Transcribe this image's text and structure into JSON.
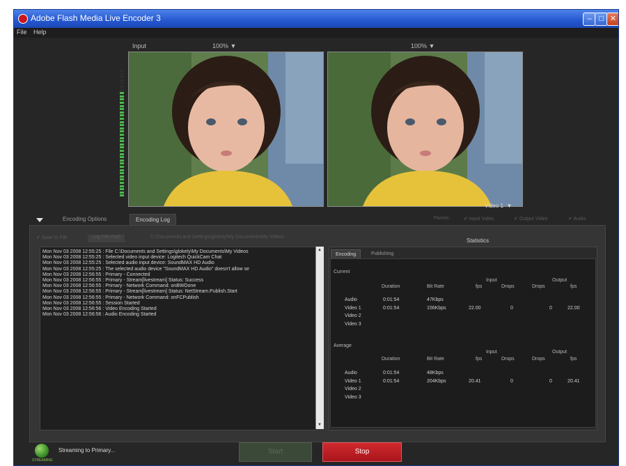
{
  "window": {
    "title": "Adobe Flash Media Live Encoder 3",
    "menu": [
      "File",
      "Help"
    ]
  },
  "preview": {
    "input_label": "Input",
    "input_zoom": "100%",
    "output_zoom": "100%",
    "video_select": "Video 1",
    "vu_level": 0.82
  },
  "tabs": {
    "encoding_options": "Encoding Options",
    "encoding_log": "Encoding Log"
  },
  "panel_toggles": {
    "label": "Panels:",
    "items": [
      "Input Video",
      "Output Video",
      "Audio"
    ]
  },
  "log_toolbar": {
    "save_to_file": "Save to File",
    "log_file_path": "C:\\Documents and Settings\\glokely\\My Documents\\My Videos"
  },
  "log": {
    "lines": [
      "Mon Nov 03 2008 12:55:25 : File C:\\Documents and Settings\\glokely\\My Documents\\My Videos",
      "Mon Nov 03 2008 12:55:25 : Selected video input device: Logitech QuickCam Chat",
      "Mon Nov 03 2008 12:55:25 : Selected audio input device: SoundMAX HD Audio",
      "Mon Nov 03 2008 12:55:25 : The selected audio device \"SoundMAX HD Audio\" doesn't allow se",
      "Mon Nov 03 2008 12:56:55 : Primary - Connected",
      "Mon Nov 03 2008 12:56:55 : Primary - Stream[livestream] Status: Success",
      "Mon Nov 03 2008 12:56:55 : Primary - Network Command: onBWDone",
      "Mon Nov 03 2008 12:56:55 : Primary - Stream[livestream] Status: NetStream.Publish.Start",
      "Mon Nov 03 2008 12:56:55 : Primary - Network Command: onFCPublish",
      "Mon Nov 03 2008 12:56:55 : Session Started",
      "Mon Nov 03 2008 12:56:56 : Video Encoding Started",
      "Mon Nov 03 2008 12:56:56 : Audio Encoding Started"
    ]
  },
  "stats": {
    "title": "Statistics",
    "tabs": [
      "Encoding",
      "Publishing"
    ],
    "current_label": "Current",
    "average_label": "Average",
    "col_headers": {
      "duration": "Duration",
      "bitrate": "Bit Rate",
      "input": "Input",
      "output": "Output",
      "fps": "fps",
      "drops": "Drops"
    },
    "current": [
      {
        "name": "Audio",
        "duration": "0:01:54",
        "bitrate": "47Kbps",
        "in_fps": "",
        "in_drops": "",
        "out_drops": "",
        "out_fps": ""
      },
      {
        "name": "Video 1",
        "duration": "0:01:54",
        "bitrate": "156Kbps",
        "in_fps": "22.00",
        "in_drops": "0",
        "out_drops": "0",
        "out_fps": "22.00"
      },
      {
        "name": "Video 2",
        "duration": "",
        "bitrate": "",
        "in_fps": "",
        "in_drops": "",
        "out_drops": "",
        "out_fps": ""
      },
      {
        "name": "Video 3",
        "duration": "",
        "bitrate": "",
        "in_fps": "",
        "in_drops": "",
        "out_drops": "",
        "out_fps": ""
      }
    ],
    "average": [
      {
        "name": "Audio",
        "duration": "0:01:54",
        "bitrate": "48Kbps",
        "in_fps": "",
        "in_drops": "",
        "out_drops": "",
        "out_fps": ""
      },
      {
        "name": "Video 1",
        "duration": "0:01:54",
        "bitrate": "204Kbps",
        "in_fps": "20.41",
        "in_drops": "0",
        "out_drops": "0",
        "out_fps": "20.41"
      },
      {
        "name": "Video 2",
        "duration": "",
        "bitrate": "",
        "in_fps": "",
        "in_drops": "",
        "out_drops": "",
        "out_fps": ""
      },
      {
        "name": "Video 3",
        "duration": "",
        "bitrate": "",
        "in_fps": "",
        "in_drops": "",
        "out_drops": "",
        "out_fps": ""
      }
    ]
  },
  "status": {
    "globe_label": "STREAMING",
    "text": "Streaming to Primary...",
    "start_label": "Start",
    "stop_label": "Stop"
  },
  "colors": {
    "stop_red": "#c41e24",
    "vu_green": "#4bb84b",
    "title_blue": "#2457cf"
  }
}
